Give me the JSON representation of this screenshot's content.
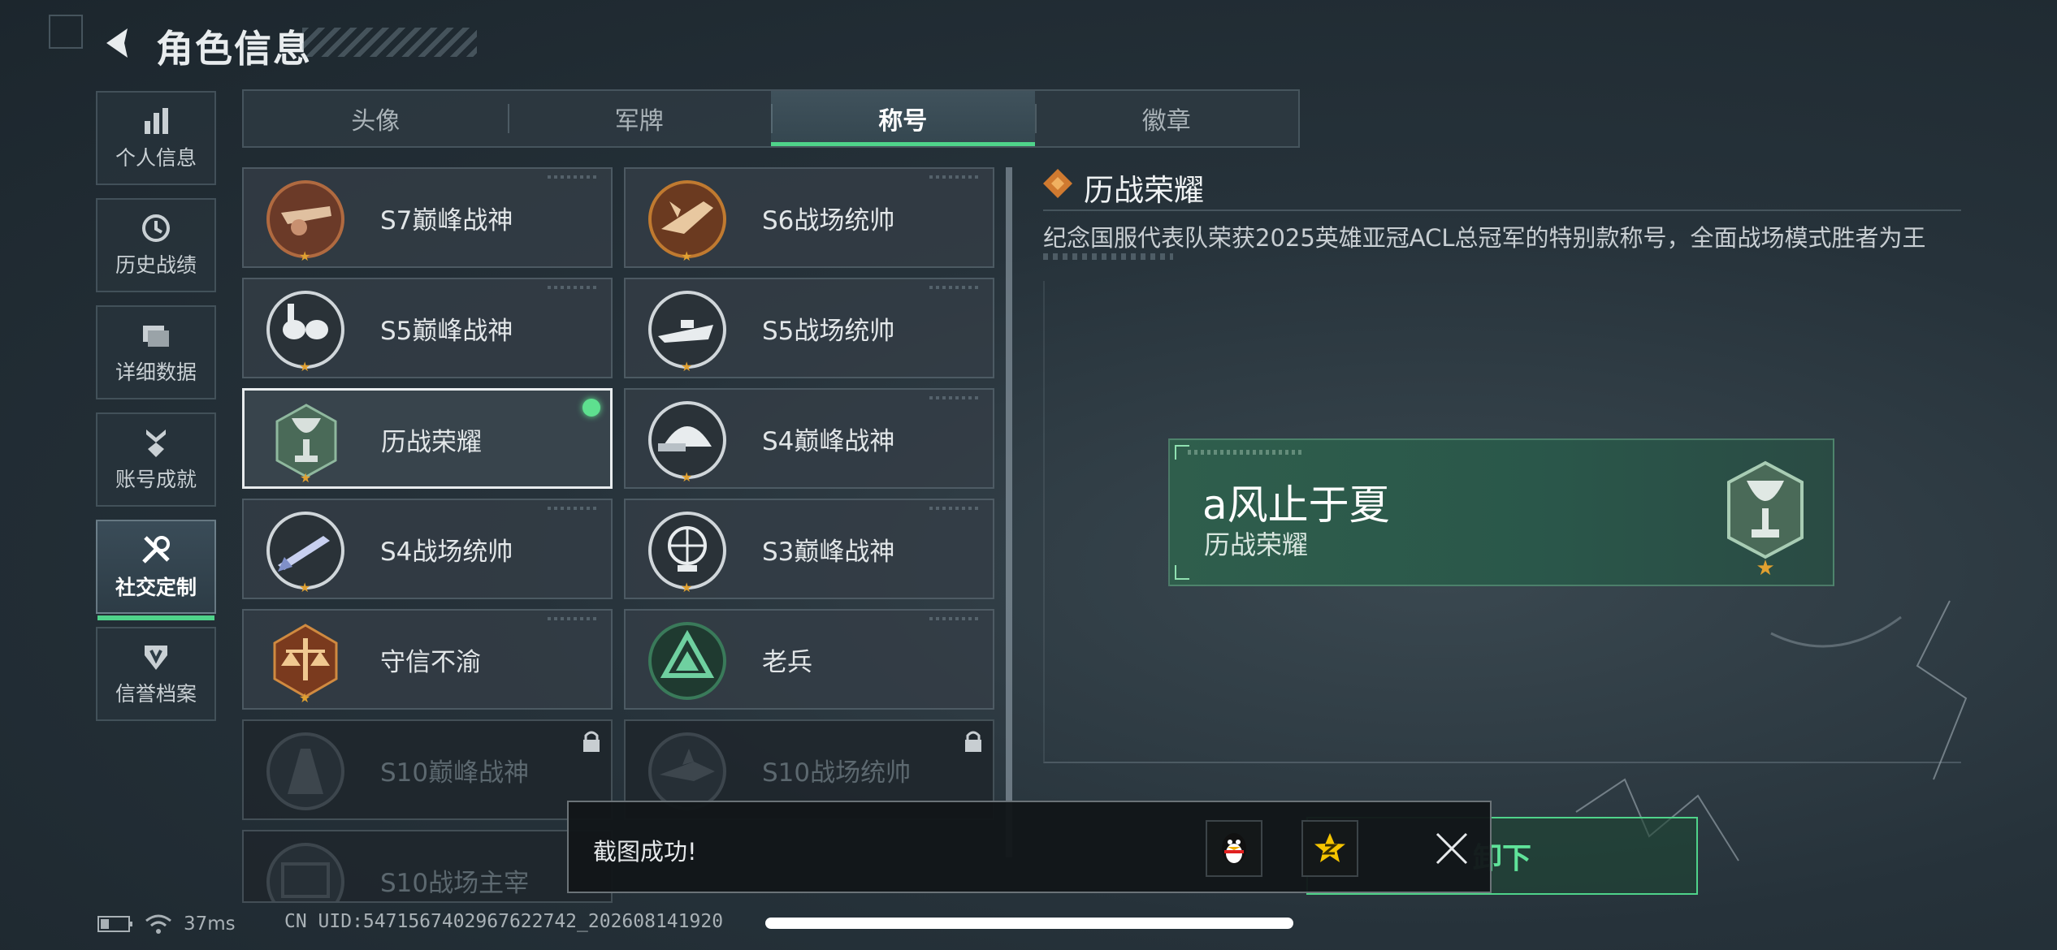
{
  "header": {
    "title": "角色信息"
  },
  "sidebar": {
    "items": [
      {
        "label": "个人信息",
        "icon": "bar-chart-icon"
      },
      {
        "label": "历史战绩",
        "icon": "clock-icon"
      },
      {
        "label": "详细数据",
        "icon": "folder-icon"
      },
      {
        "label": "账号成就",
        "icon": "medal-icon"
      },
      {
        "label": "社交定制",
        "icon": "tools-icon",
        "active": true
      },
      {
        "label": "信誉档案",
        "icon": "shield-icon"
      }
    ]
  },
  "tabs": [
    {
      "label": "头像"
    },
    {
      "label": "军牌"
    },
    {
      "label": "称号",
      "active": true
    },
    {
      "label": "徽章"
    }
  ],
  "titles": [
    {
      "name": "S7巅峰战神",
      "icon": "cannon-badge-icon"
    },
    {
      "name": "S6战场统帅",
      "icon": "jet-badge-icon"
    },
    {
      "name": "S5巅峰战神",
      "icon": "diver-mask-badge-icon"
    },
    {
      "name": "S5战场统帅",
      "icon": "speedboat-badge-icon"
    },
    {
      "name": "历战荣耀",
      "icon": "trophy-badge-icon",
      "selected": true,
      "equipped": true
    },
    {
      "name": "S4巅峰战神",
      "icon": "helmet-badge-icon"
    },
    {
      "name": "S4战场统帅",
      "icon": "missile-badge-icon"
    },
    {
      "name": "S3巅峰战神",
      "icon": "globe-badge-icon"
    },
    {
      "name": "守信不渝",
      "icon": "scales-badge-icon"
    },
    {
      "name": "老兵",
      "icon": "veteran-triangle-icon"
    },
    {
      "name": "S10巅峰战神",
      "icon": "tower-badge-icon",
      "locked": true
    },
    {
      "name": "S10战场统帅",
      "icon": "shark-badge-icon",
      "locked": true
    },
    {
      "name": "S10战场主宰",
      "icon": "colosseum-badge-icon",
      "locked": true
    }
  ],
  "detail": {
    "title": "历战荣耀",
    "description": "纪念国服代表队荣获2025英雄亚冠ACL总冠军的特别款称号，全面战场模式胜者为王"
  },
  "preview": {
    "player_name": "a风止于夏",
    "title_name": "历战荣耀"
  },
  "actions": {
    "unequip_label": "卸下"
  },
  "toast": {
    "message": "截图成功!"
  },
  "status": {
    "ping": "37ms",
    "uid": "CN UID:5471567402967622742_202608141920"
  },
  "colors": {
    "accent": "#4fd38a",
    "background": "#26323a",
    "card": "#343e46",
    "preview": "#2f5e4c"
  }
}
